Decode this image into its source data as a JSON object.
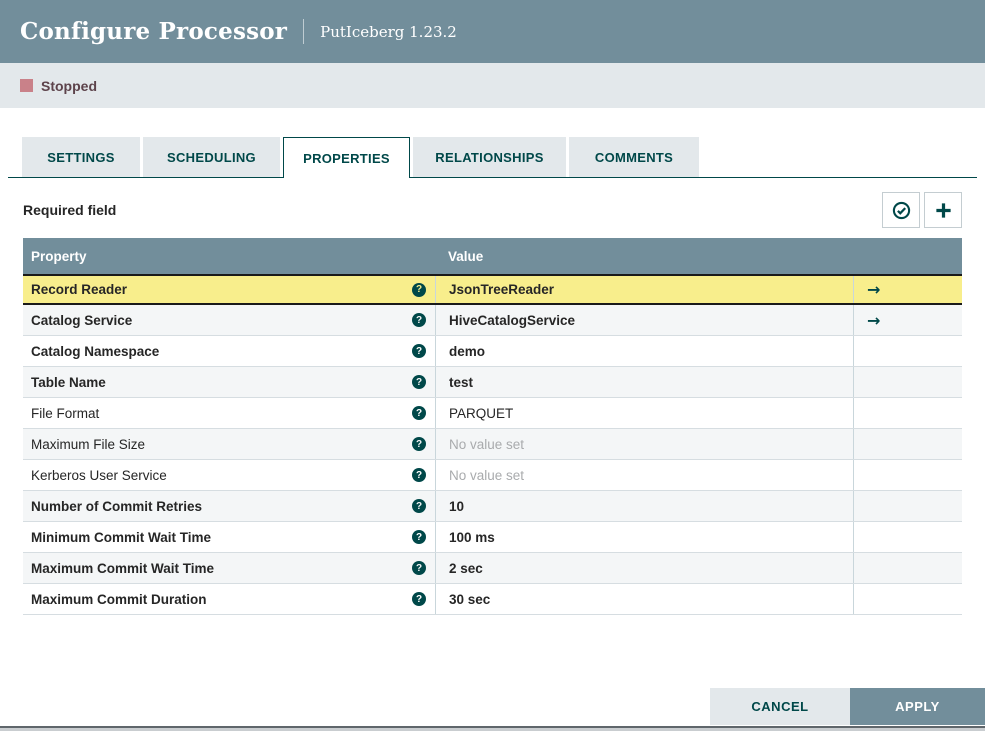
{
  "dialog": {
    "title": "Configure Processor",
    "subtitle": "PutIceberg 1.23.2"
  },
  "status": {
    "label": "Stopped"
  },
  "tabs": [
    {
      "label": "SETTINGS",
      "active": false
    },
    {
      "label": "SCHEDULING",
      "active": false
    },
    {
      "label": "PROPERTIES",
      "active": true
    },
    {
      "label": "RELATIONSHIPS",
      "active": false
    },
    {
      "label": "COMMENTS",
      "active": false
    }
  ],
  "properties_tab": {
    "required_note": "Required field",
    "toolbar": {
      "verify_icon": "check-circle-icon",
      "add_icon": "plus-icon"
    },
    "table": {
      "columns": [
        "Property",
        "Value"
      ],
      "rows": [
        {
          "property": "Record Reader",
          "value": "JsonTreeReader",
          "required": true,
          "empty": false,
          "selected": true,
          "has_goto": true
        },
        {
          "property": "Catalog Service",
          "value": "HiveCatalogService",
          "required": true,
          "empty": false,
          "selected": false,
          "has_goto": true
        },
        {
          "property": "Catalog Namespace",
          "value": "demo",
          "required": true,
          "empty": false,
          "selected": false,
          "has_goto": false
        },
        {
          "property": "Table Name",
          "value": "test",
          "required": true,
          "empty": false,
          "selected": false,
          "has_goto": false
        },
        {
          "property": "File Format",
          "value": "PARQUET",
          "required": false,
          "empty": false,
          "selected": false,
          "has_goto": false
        },
        {
          "property": "Maximum File Size",
          "value": "No value set",
          "required": false,
          "empty": true,
          "selected": false,
          "has_goto": false
        },
        {
          "property": "Kerberos User Service",
          "value": "No value set",
          "required": false,
          "empty": true,
          "selected": false,
          "has_goto": false
        },
        {
          "property": "Number of Commit Retries",
          "value": "10",
          "required": true,
          "empty": false,
          "selected": false,
          "has_goto": false
        },
        {
          "property": "Minimum Commit Wait Time",
          "value": "100 ms",
          "required": true,
          "empty": false,
          "selected": false,
          "has_goto": false
        },
        {
          "property": "Maximum Commit Wait Time",
          "value": "2 sec",
          "required": true,
          "empty": false,
          "selected": false,
          "has_goto": false
        },
        {
          "property": "Maximum Commit Duration",
          "value": "30 sec",
          "required": true,
          "empty": false,
          "selected": false,
          "has_goto": false
        }
      ]
    }
  },
  "footer": {
    "cancel_label": "CANCEL",
    "apply_label": "APPLY"
  },
  "icons": {
    "help_glyph": "?",
    "goto_glyph": "→"
  },
  "colors": {
    "header_bg": "#728E9B",
    "accent_teal": "#004849",
    "statusbar_bg": "#E3E8EB",
    "stopped_red": "#C98189",
    "stopped_text": "#5D434B",
    "selected_yellow": "#F8EE8C",
    "row_alt": "#F4F6F7",
    "muted_text": "#A9ABAD"
  }
}
